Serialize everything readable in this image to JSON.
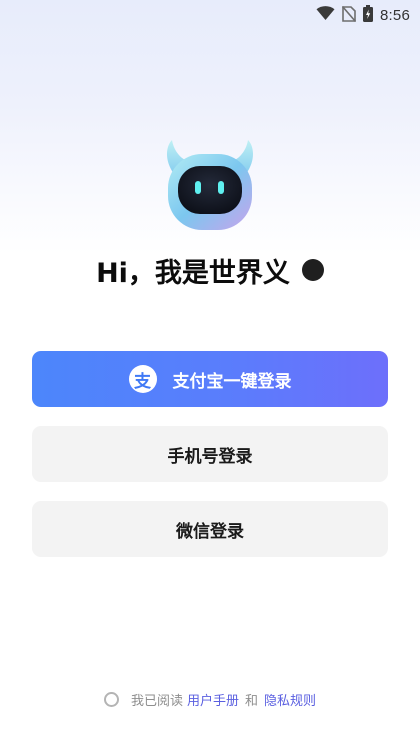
{
  "status_bar": {
    "time": "8:56",
    "icons": [
      "wifi-icon",
      "no-sim-icon",
      "battery-icon"
    ]
  },
  "mascot": {
    "icon": "robot-mascot-icon",
    "colors": {
      "body_light": "#a9e6f2",
      "body_mid": "#7fc6ef",
      "body_pink": "#c9a2ea",
      "face": "#141824",
      "eyes": "#5ff0f0"
    }
  },
  "greeting": {
    "text": "Hi，我是世界义"
  },
  "buttons": {
    "alipay": {
      "icon_glyph": "支",
      "label": "支付宝一键登录",
      "colors": {
        "start": "#4c86fb",
        "end": "#6d6ffb"
      }
    },
    "phone": {
      "label": "手机号登录"
    },
    "wechat": {
      "label": "微信登录"
    }
  },
  "agreement": {
    "checked": false,
    "prefix": "我已阅读",
    "user_manual": "用户手册",
    "conjunction": "和",
    "privacy_rules": "隐私规则",
    "link_color": "#5a5fe0"
  }
}
